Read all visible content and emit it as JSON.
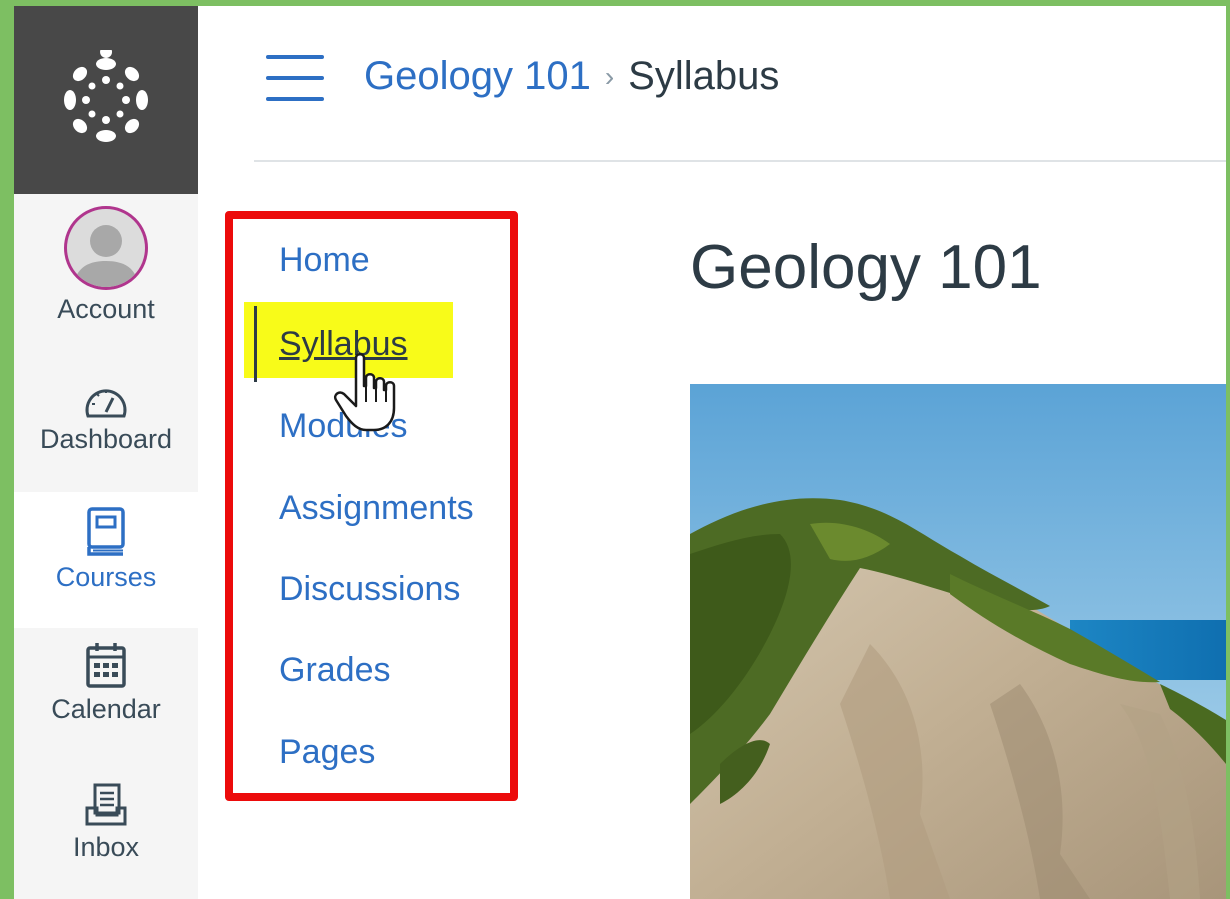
{
  "global_nav": {
    "items": [
      {
        "label": "Account",
        "icon": "avatar"
      },
      {
        "label": "Dashboard",
        "icon": "dashboard-icon"
      },
      {
        "label": "Courses",
        "icon": "courses-icon",
        "active": true
      },
      {
        "label": "Calendar",
        "icon": "calendar-icon"
      },
      {
        "label": "Inbox",
        "icon": "inbox-icon"
      }
    ]
  },
  "header": {
    "breadcrumb": {
      "course": "Geology 101",
      "separator": "›",
      "current": "Syllabus"
    }
  },
  "course_nav": {
    "items": [
      {
        "label": "Home"
      },
      {
        "label": "Syllabus",
        "current": true
      },
      {
        "label": "Modules"
      },
      {
        "label": "Assignments"
      },
      {
        "label": "Discussions"
      },
      {
        "label": "Grades"
      },
      {
        "label": "Pages"
      }
    ]
  },
  "main": {
    "title": "Geology 101"
  },
  "colors": {
    "link": "#2d6fc4",
    "highlight": "#f8fb19",
    "outline": "#ec0b0b",
    "nav_dark": "#484848"
  }
}
